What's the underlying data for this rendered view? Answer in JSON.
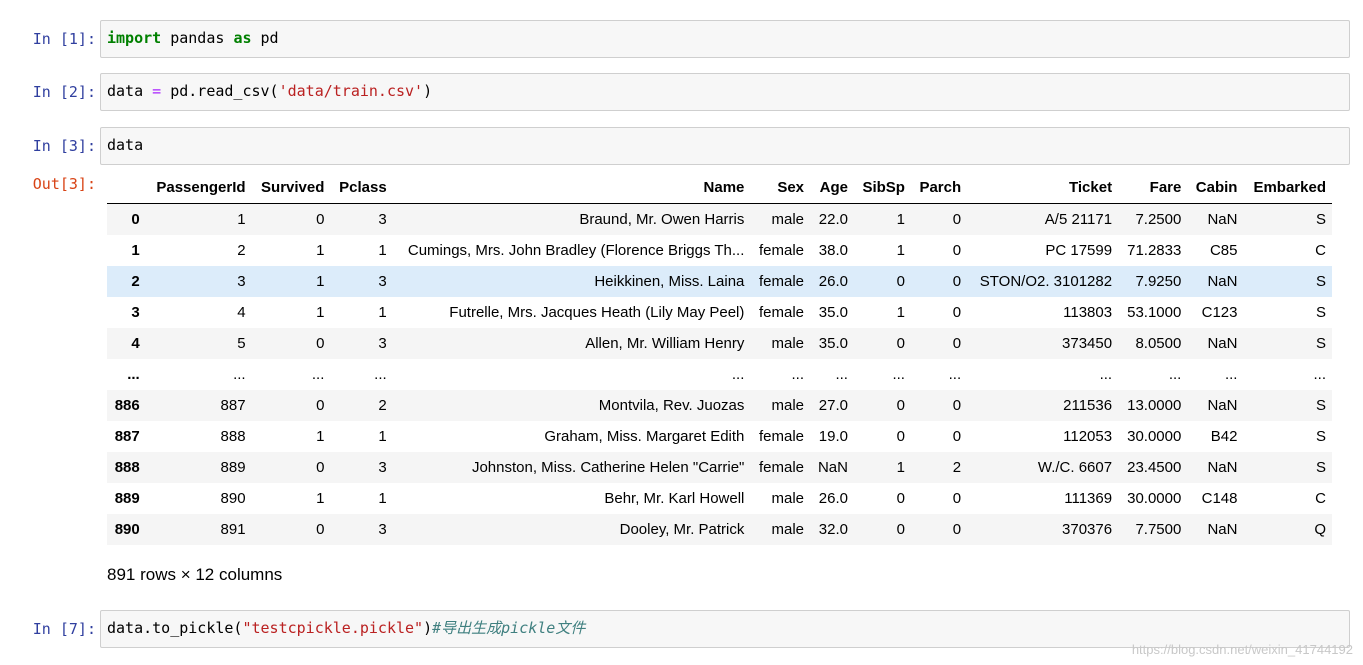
{
  "cells": [
    {
      "prompt": "In  [1]:",
      "tokens": [
        {
          "t": "import",
          "c": "kw"
        },
        {
          "t": " pandas ",
          "c": ""
        },
        {
          "t": "as",
          "c": "kw"
        },
        {
          "t": " pd",
          "c": ""
        }
      ]
    },
    {
      "prompt": "In  [2]:",
      "tokens": [
        {
          "t": "data ",
          "c": ""
        },
        {
          "t": "=",
          "c": "op"
        },
        {
          "t": " pd.read_csv(",
          "c": ""
        },
        {
          "t": "'data/train.csv'",
          "c": "str"
        },
        {
          "t": ")",
          "c": ""
        }
      ]
    },
    {
      "prompt": "In  [3]:",
      "tokens": [
        {
          "t": "data",
          "c": ""
        }
      ]
    },
    {
      "prompt": "In  [7]:",
      "tokens": [
        {
          "t": "data.to_pickle(",
          "c": ""
        },
        {
          "t": "\"testcpickle.pickle\"",
          "c": "str"
        },
        {
          "t": ")",
          "c": ""
        },
        {
          "t": "#导出生成pickle文件",
          "c": "cm"
        }
      ]
    }
  ],
  "output": {
    "prompt": "Out[3]:",
    "columns": [
      "",
      "PassengerId",
      "Survived",
      "Pclass",
      "Name",
      "Sex",
      "Age",
      "SibSp",
      "Parch",
      "Ticket",
      "Fare",
      "Cabin",
      "Embarked"
    ],
    "rows": [
      [
        "0",
        "1",
        "0",
        "3",
        "Braund, Mr. Owen Harris",
        "male",
        "22.0",
        "1",
        "0",
        "A/5 21171",
        "7.2500",
        "NaN",
        "S"
      ],
      [
        "1",
        "2",
        "1",
        "1",
        "Cumings, Mrs. John Bradley (Florence Briggs Th...",
        "female",
        "38.0",
        "1",
        "0",
        "PC 17599",
        "71.2833",
        "C85",
        "C"
      ],
      [
        "2",
        "3",
        "1",
        "3",
        "Heikkinen, Miss. Laina",
        "female",
        "26.0",
        "0",
        "0",
        "STON/O2. 3101282",
        "7.9250",
        "NaN",
        "S"
      ],
      [
        "3",
        "4",
        "1",
        "1",
        "Futrelle, Mrs. Jacques Heath (Lily May Peel)",
        "female",
        "35.0",
        "1",
        "0",
        "113803",
        "53.1000",
        "C123",
        "S"
      ],
      [
        "4",
        "5",
        "0",
        "3",
        "Allen, Mr. William Henry",
        "male",
        "35.0",
        "0",
        "0",
        "373450",
        "8.0500",
        "NaN",
        "S"
      ],
      [
        "...",
        "...",
        "...",
        "...",
        "...",
        "...",
        "...",
        "...",
        "...",
        "...",
        "...",
        "...",
        "..."
      ],
      [
        "886",
        "887",
        "0",
        "2",
        "Montvila, Rev. Juozas",
        "male",
        "27.0",
        "0",
        "0",
        "211536",
        "13.0000",
        "NaN",
        "S"
      ],
      [
        "887",
        "888",
        "1",
        "1",
        "Graham, Miss. Margaret Edith",
        "female",
        "19.0",
        "0",
        "0",
        "112053",
        "30.0000",
        "B42",
        "S"
      ],
      [
        "888",
        "889",
        "0",
        "3",
        "Johnston, Miss. Catherine Helen \"Carrie\"",
        "female",
        "NaN",
        "1",
        "2",
        "W./C. 6607",
        "23.4500",
        "NaN",
        "S"
      ],
      [
        "889",
        "890",
        "1",
        "1",
        "Behr, Mr. Karl Howell",
        "male",
        "26.0",
        "0",
        "0",
        "111369",
        "30.0000",
        "C148",
        "C"
      ],
      [
        "890",
        "891",
        "0",
        "3",
        "Dooley, Mr. Patrick",
        "male",
        "32.0",
        "0",
        "0",
        "370376",
        "7.7500",
        "NaN",
        "Q"
      ]
    ],
    "highlighted_row": 2,
    "ellipsis_row": 5,
    "shape": "891 rows × 12 columns"
  },
  "watermark": "https://blog.csdn.net/weixin_41744192",
  "colors": {
    "prompt_in": "#303f9f",
    "prompt_out": "#d84315",
    "keyword": "#008000",
    "string": "#ba2121",
    "comment": "#408080",
    "highlight_row": "#dcecfa"
  }
}
